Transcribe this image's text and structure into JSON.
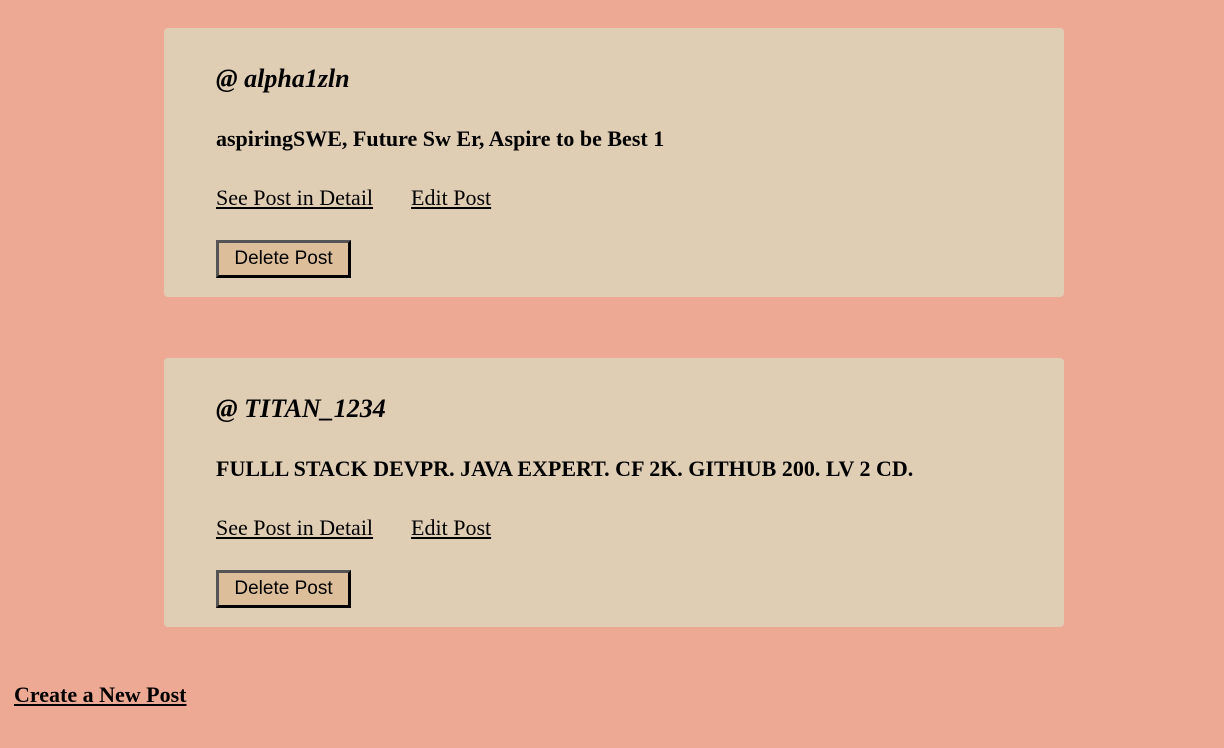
{
  "posts": [
    {
      "user": "@ alpha1zln",
      "content": "aspiringSWE, Future Sw Er, Aspire to be Best 1",
      "detail_link": "See Post in Detail",
      "edit_link": "Edit Post",
      "delete_button": "Delete Post"
    },
    {
      "user": "@ TITAN_1234",
      "content": "FULLL STACK DEVPR. JAVA EXPERT. CF 2K. GITHUB 200. LV 2 CD.",
      "detail_link": "See Post in Detail",
      "edit_link": "Edit Post",
      "delete_button": "Delete Post"
    }
  ],
  "create_link": "Create a New Post"
}
